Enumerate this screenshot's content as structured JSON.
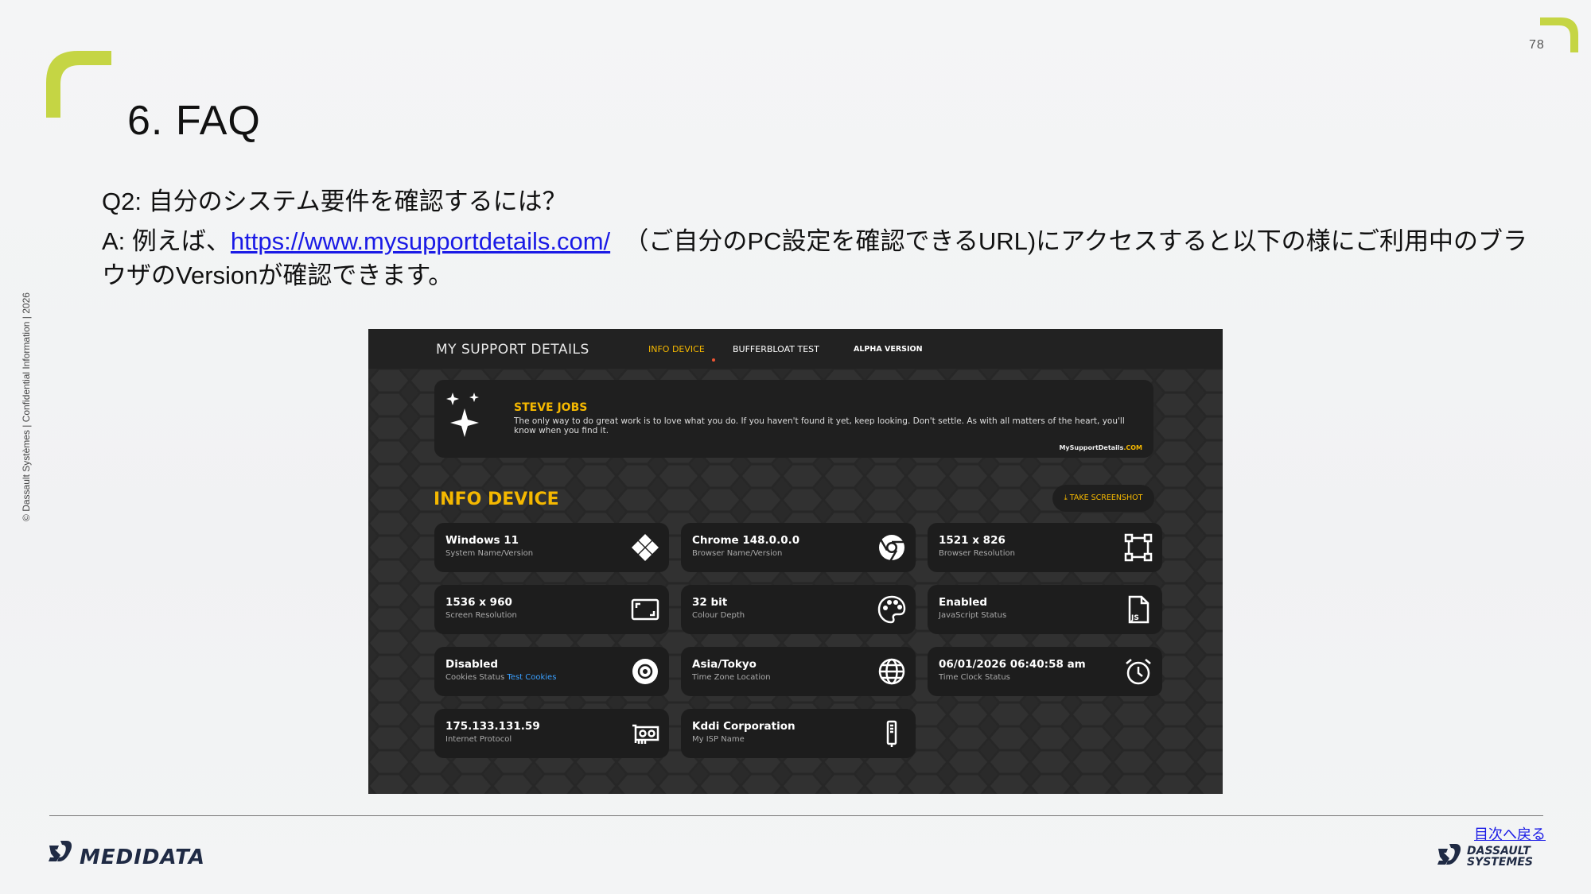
{
  "page_number": "78",
  "side_note": "© Dassault Systèmes | Confidential Information | 2026",
  "title": "6. FAQ",
  "question": "Q2: 自分のシステム要件を確認するには？",
  "answer": {
    "prefix": "A: 例えば、",
    "link_text": "https://www.mysupportdetails.com/",
    "suffix": "（ご自分のPC設定を確認できるURL)にアクセスすると以下の様にご利用中のブラウザのVersionが確認できます。"
  },
  "screenshot": {
    "logo": "MY SUPPORT DETAILS",
    "nav": [
      "INFO DEVICE",
      "BUFFERBLOAT TEST",
      "ALPHA VERSION"
    ],
    "quote": {
      "author": "STEVE JOBS",
      "text": "The only way to do great work is to love what you do. If you haven't found it yet, keep looking. Don't settle. As with all matters of the heart, you'll know when you find it.",
      "site": "MySupportDetails",
      "site_com": ".COM"
    },
    "section_title": "INFO DEVICE",
    "screenshot_button": "⤓ TAKE SCREENSHOT",
    "cards": [
      {
        "value": "Windows 11",
        "label": "System Name/Version",
        "icon": "windows-icon"
      },
      {
        "value": "Chrome 148.0.0.0",
        "label": "Browser Name/Version",
        "icon": "chrome-icon"
      },
      {
        "value": "1521 x 826",
        "label": "Browser Resolution",
        "icon": "resize-icon"
      },
      {
        "value": "1536 x 960",
        "label": "Screen Resolution",
        "icon": "screen-icon"
      },
      {
        "value": "32 bit",
        "label": "Colour Depth",
        "icon": "palette-icon"
      },
      {
        "value": "Enabled",
        "label": "JavaScript Status",
        "icon": "js-file-icon"
      },
      {
        "value": "Disabled",
        "label": "Cookies Status",
        "label_link": "Test Cookies",
        "icon": "cookie-icon"
      },
      {
        "value": "Asia/Tokyo",
        "label": "Time Zone Location",
        "icon": "globe-icon"
      },
      {
        "value": "06/01/2026 06:40:58 am",
        "label": "Time Clock Status",
        "icon": "alarm-clock-icon"
      },
      {
        "value": "175.133.131.59",
        "label": "Internet Protocol",
        "icon": "network-card-icon"
      },
      {
        "value": "Kddi Corporation",
        "label": "My ISP Name",
        "icon": "router-icon"
      }
    ]
  },
  "footer": {
    "toc_link": "目次へ戻る",
    "medidata_logo": "MEDIDATA",
    "dassault_logo_line1": "DASSAULT",
    "dassault_logo_line2": "SYSTEMES"
  },
  "colors": {
    "accent_green": "#c5d544",
    "screenshot_accent": "#f5b800",
    "link": "#1a1ae6"
  }
}
